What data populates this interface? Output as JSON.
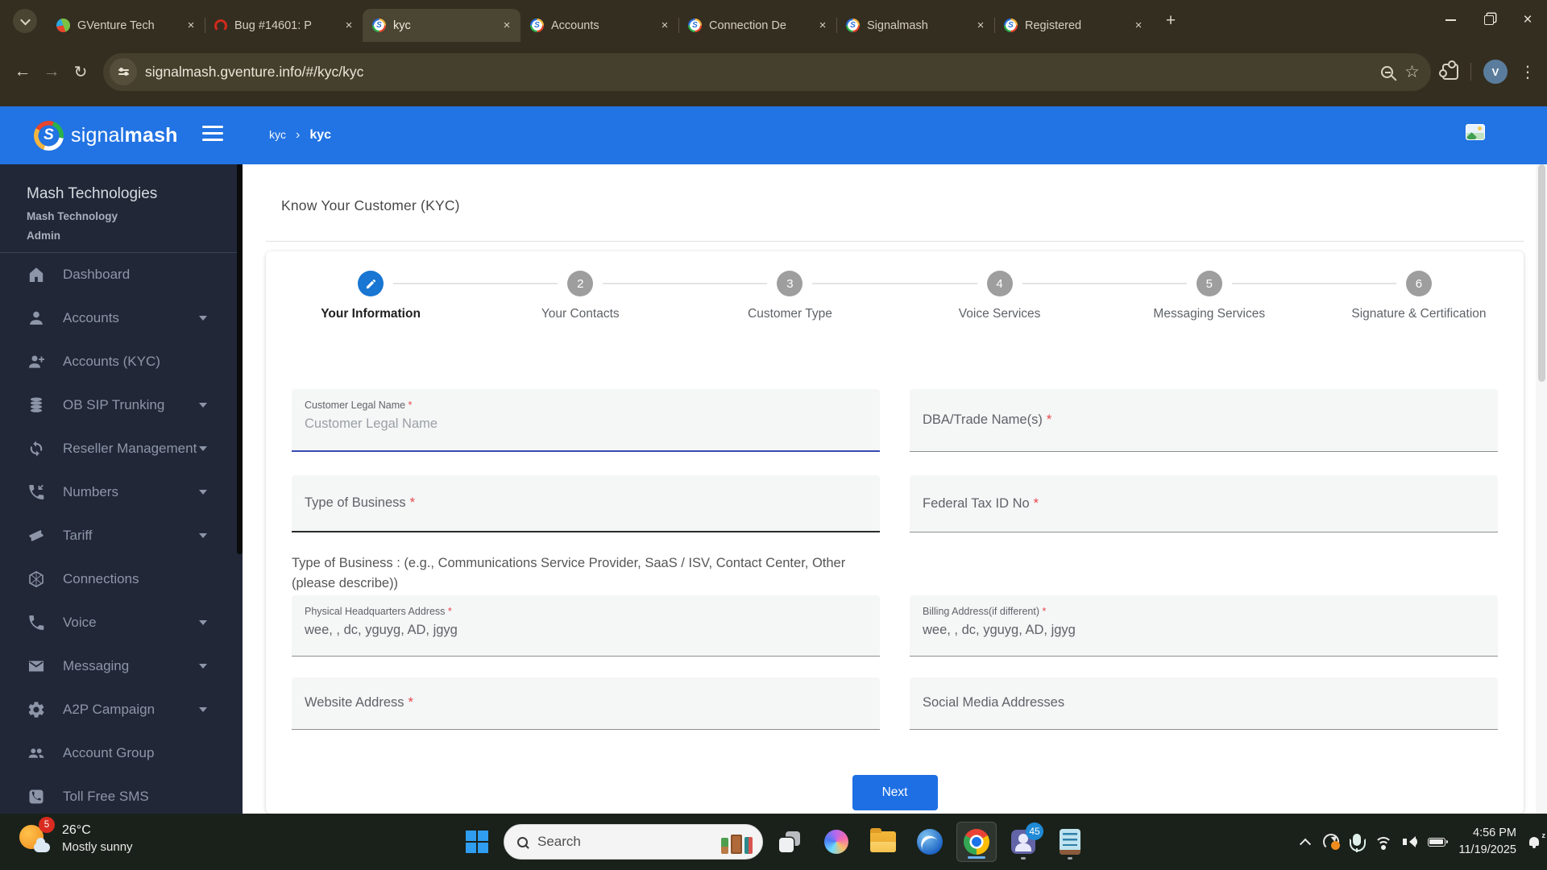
{
  "browser": {
    "tabs": [
      {
        "title": "GVenture Tech",
        "favicon": "gventure",
        "active": false
      },
      {
        "title": "Bug #14601: P",
        "favicon": "redmine",
        "active": false
      },
      {
        "title": "kyc",
        "favicon": "signalmash",
        "active": true
      },
      {
        "title": "Accounts",
        "favicon": "signalmash",
        "active": false
      },
      {
        "title": "Connection De",
        "favicon": "signalmash",
        "active": false
      },
      {
        "title": "Signalmash",
        "favicon": "signalmash",
        "active": false
      },
      {
        "title": "Registered",
        "favicon": "signalmash",
        "active": false
      }
    ],
    "url": "signalmash.gventure.info/#/kyc/kyc",
    "profile_initial": "V"
  },
  "app": {
    "brand": {
      "prefix": "signal",
      "suffix": "mash",
      "letter": "S"
    },
    "breadcrumb": {
      "parent": "kyc",
      "separator": "›",
      "current": "kyc"
    },
    "sidebar": {
      "org": "Mash Technologies",
      "account": "Mash Technology",
      "role": "Admin",
      "items": [
        {
          "label": "Dashboard",
          "icon": "home",
          "expandable": false
        },
        {
          "label": "Accounts",
          "icon": "person",
          "expandable": true
        },
        {
          "label": "Accounts (KYC)",
          "icon": "person-add",
          "expandable": false
        },
        {
          "label": "OB SIP Trunking",
          "icon": "database",
          "expandable": true
        },
        {
          "label": "Reseller Management",
          "icon": "sync",
          "expandable": true
        },
        {
          "label": "Numbers",
          "icon": "phone-in",
          "expandable": true
        },
        {
          "label": "Tariff",
          "icon": "ticket",
          "expandable": true
        },
        {
          "label": "Connections",
          "icon": "hexagon",
          "expandable": false
        },
        {
          "label": "Voice",
          "icon": "phone",
          "expandable": true
        },
        {
          "label": "Messaging",
          "icon": "envelope",
          "expandable": true
        },
        {
          "label": "A2P Campaign",
          "icon": "gear",
          "expandable": true
        },
        {
          "label": "Account Group",
          "icon": "people",
          "expandable": false
        },
        {
          "label": "Toll Free SMS",
          "icon": "phone-box",
          "expandable": false
        }
      ]
    },
    "page": {
      "title": "Know Your Customer (KYC)",
      "required_mark": "*",
      "steps": [
        {
          "num": "1",
          "label": "Your Information",
          "active": true
        },
        {
          "num": "2",
          "label": "Your Contacts",
          "active": false
        },
        {
          "num": "3",
          "label": "Customer Type",
          "active": false
        },
        {
          "num": "4",
          "label": "Voice Services",
          "active": false
        },
        {
          "num": "5",
          "label": "Messaging Services",
          "active": false
        },
        {
          "num": "6",
          "label": "Signature & Certification",
          "active": false
        }
      ],
      "fields": {
        "customer_legal_name": {
          "label": "Customer Legal Name",
          "placeholder": "Customer Legal Name",
          "value": ""
        },
        "dba_trade_name": {
          "label": "DBA/Trade Name(s)"
        },
        "type_of_business": {
          "label": "Type of Business"
        },
        "federal_tax_id": {
          "label": "Federal Tax ID No"
        },
        "physical_hq_address": {
          "label": "Physical Headquarters Address",
          "value": "wee, , dc, yguyg, AD, jgyg"
        },
        "billing_address": {
          "label": "Billing Address(if different)",
          "value": "wee, , dc, yguyg, AD, jgyg"
        },
        "website_address": {
          "label": "Website Address"
        },
        "social_media": {
          "label": "Social Media Addresses"
        }
      },
      "helper_text": "Type of Business : (e.g., Communications Service Provider, SaaS / ISV, Contact Center, Other (please describe))",
      "next_label": "Next"
    }
  },
  "taskbar": {
    "weather": {
      "badge": "5",
      "temp": "26°C",
      "condition": "Mostly sunny"
    },
    "search_placeholder": "Search",
    "teams_badge": "45",
    "clock": {
      "time": "4:56 PM",
      "date": "11/19/2025"
    }
  }
}
